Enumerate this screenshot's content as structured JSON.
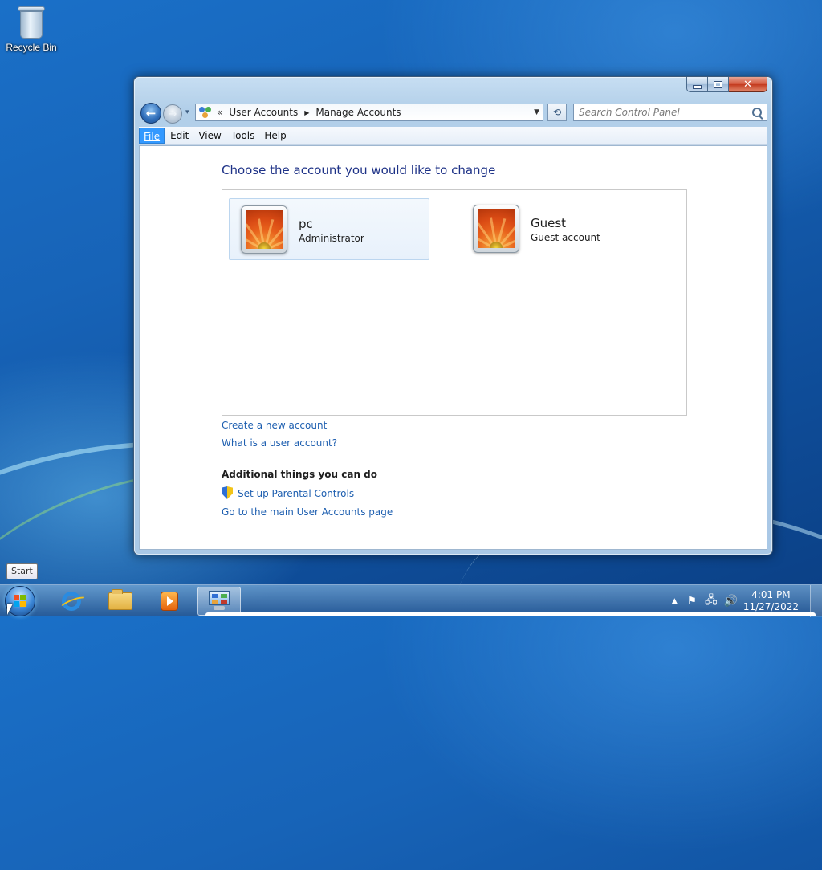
{
  "desktop": {
    "icons": [
      {
        "label": "Recycle Bin",
        "icon": "recycle-bin-icon"
      }
    ]
  },
  "window": {
    "caption_buttons": {
      "minimize": "minimize",
      "maximize": "maximize",
      "close": "✕"
    },
    "nav": {
      "back_glyph": "←",
      "forward_glyph": "→",
      "history_glyph": "▾",
      "breadcrumb_overflow": "«",
      "breadcrumbs": [
        "User Accounts",
        "Manage Accounts"
      ],
      "breadcrumb_separator": "▶",
      "address_dropdown_glyph": "▼",
      "refresh_glyph": "⟲",
      "search_placeholder": "Search Control Panel"
    },
    "menu": {
      "items": [
        {
          "label": "File",
          "active": true
        },
        {
          "label": "Edit",
          "active": false
        },
        {
          "label": "View",
          "active": false
        },
        {
          "label": "Tools",
          "active": false
        },
        {
          "label": "Help",
          "active": false
        }
      ]
    },
    "content": {
      "heading": "Choose the account you would like to change",
      "accounts": [
        {
          "name": "pc",
          "type": "Administrator",
          "selected": true
        },
        {
          "name": "Guest",
          "type": "Guest account",
          "selected": false
        }
      ],
      "links": [
        "Create a new account",
        "What is a user account?"
      ],
      "additional_heading": "Additional things you can do",
      "additional_links": [
        "Set up Parental Controls",
        "Go to the main User Accounts page"
      ]
    }
  },
  "tooltip": "Start",
  "taskbar": {
    "pinned": [
      {
        "name": "internet-explorer-icon",
        "active": false
      },
      {
        "name": "folder-icon",
        "active": false
      },
      {
        "name": "media-player-icon",
        "active": false
      },
      {
        "name": "control-panel-icon",
        "active": true
      }
    ],
    "tray": {
      "show_hidden_glyph": "▲",
      "icons": [
        {
          "name": "action-center-flag-icon",
          "glyph": "⚑"
        },
        {
          "name": "network-icon",
          "glyph": "🖧"
        },
        {
          "name": "volume-icon",
          "glyph": "🔊"
        }
      ],
      "time": "4:01 PM",
      "date": "11/27/2022"
    }
  },
  "colors": {
    "link": "#1e5fb0",
    "heading": "#1e3287",
    "menu_active": "#3399ff"
  }
}
